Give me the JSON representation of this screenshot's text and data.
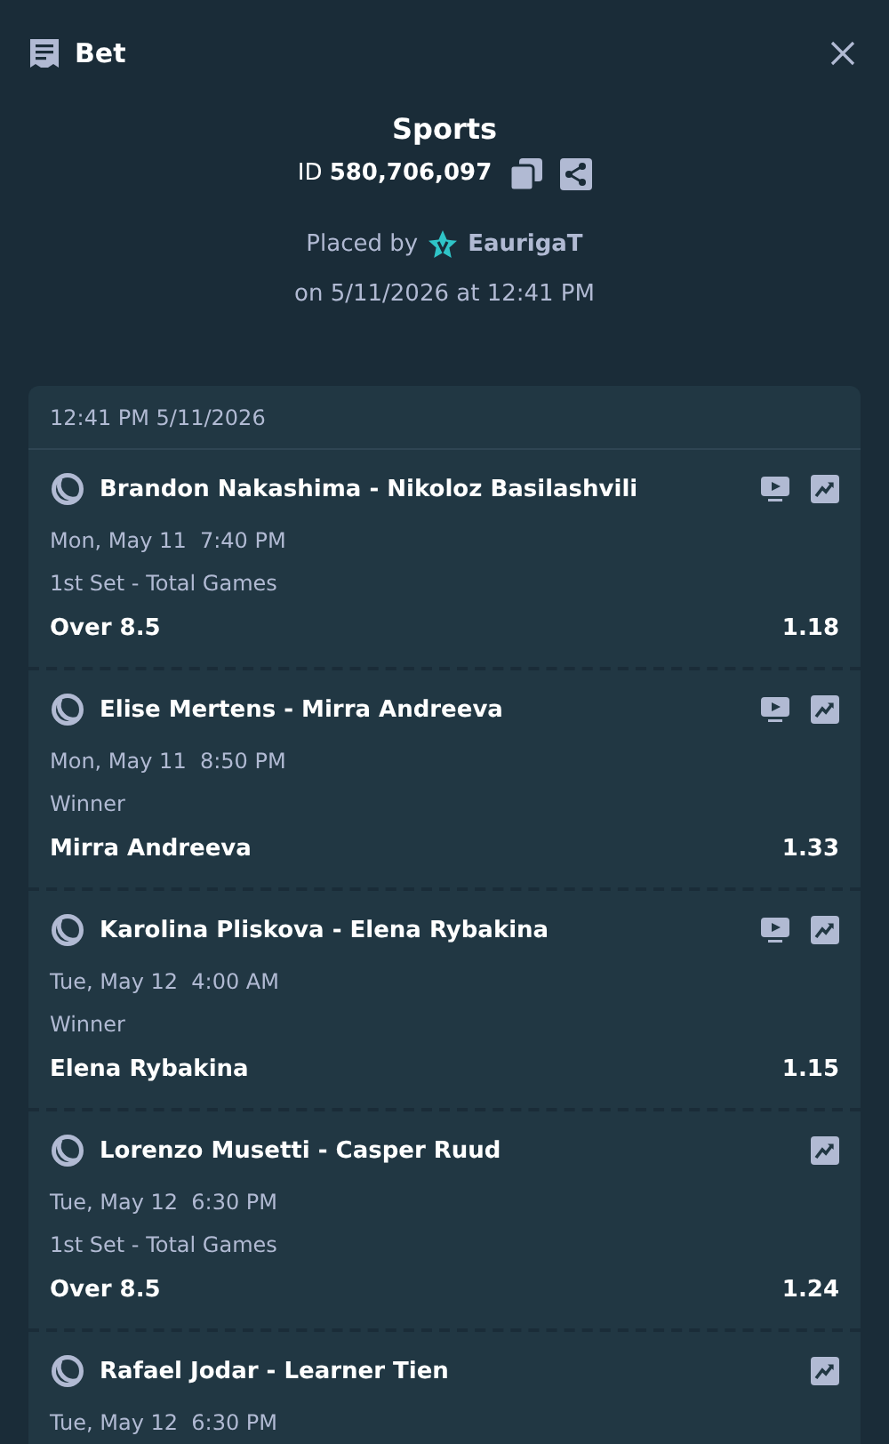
{
  "header": {
    "title": "Bet"
  },
  "bet": {
    "category": "Sports",
    "id_line": "ID **580,706,097**",
    "placed_by_label": "Placed by",
    "user": "EaurigaT",
    "placed_on": "on 5/11/2026 at 12:41 PM"
  },
  "slip": {
    "timestamp": "12:41 PM 5/11/2026",
    "legs": [
      {
        "match": "Brandon Nakashima - Nikoloz Basilashvili",
        "has_stream": true,
        "date": "Mon, May 11  7:40 PM",
        "market": "1st Set - Total Games",
        "selection": "Over 8.5",
        "odds": "1.18"
      },
      {
        "match": "Elise Mertens - Mirra Andreeva",
        "has_stream": true,
        "date": "Mon, May 11  8:50 PM",
        "market": "Winner",
        "selection": "Mirra Andreeva",
        "odds": "1.33"
      },
      {
        "match": "Karolina Pliskova - Elena Rybakina",
        "has_stream": true,
        "date": "Tue, May 12  4:00 AM",
        "market": "Winner",
        "selection": "Elena Rybakina",
        "odds": "1.15"
      },
      {
        "match": "Lorenzo Musetti - Casper Ruud",
        "has_stream": false,
        "date": "Tue, May 12  6:30 PM",
        "market": "1st Set - Total Games",
        "selection": "Over 8.5",
        "odds": "1.24"
      },
      {
        "match": "Rafael Jodar - Learner Tien",
        "has_stream": false,
        "date": "Tue, May 12  6:30 PM"
      }
    ]
  }
}
